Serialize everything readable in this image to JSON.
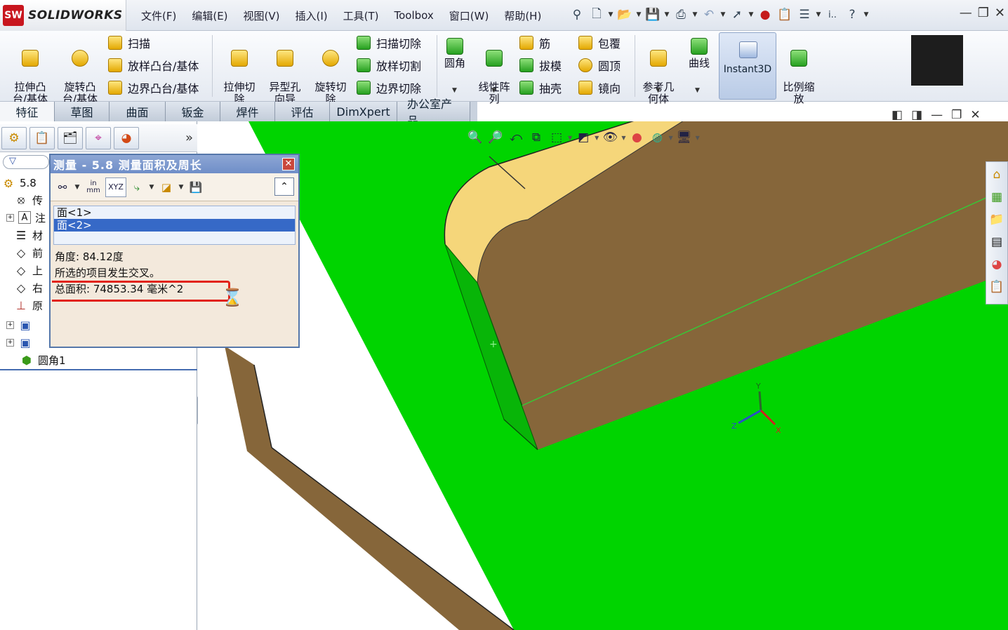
{
  "app": {
    "name": "SOLIDWORKS",
    "logo_mark": "SW"
  },
  "menu": [
    "文件(F)",
    "编辑(E)",
    "视图(V)",
    "插入(I)",
    "工具(T)",
    "Toolbox",
    "窗口(W)",
    "帮助(H)"
  ],
  "quick_access": {
    "ellipsis": "i..",
    "help": "?"
  },
  "commands": {
    "extrude_boss": "拉伸凸\n台/基体",
    "revolve_boss": "旋转凸\n台/基体",
    "sweep": "扫描",
    "loft": "放样凸台/基体",
    "boundary_boss": "边界凸台/基体",
    "extrude_cut": "拉伸切\n除",
    "hole_wizard": "异型孔\n向导",
    "revolve_cut": "旋转切\n除",
    "swept_cut": "扫描切除",
    "lofted_cut": "放样切割",
    "boundary_cut": "边界切除",
    "fillet": "圆角",
    "linear_pattern": "线性阵\n列",
    "rib": "筋",
    "draft": "拔模",
    "shell": "抽壳",
    "wrap": "包覆",
    "dome": "圆顶",
    "mirror": "镜向",
    "ref_geometry": "参考几\n何体",
    "curves": "曲线",
    "instant3d": "Instant3D",
    "scale": "比例缩\n放"
  },
  "tabs": [
    "特征",
    "草图",
    "曲面",
    "钣金",
    "焊件",
    "评估",
    "DimXpert",
    "办公室产品"
  ],
  "active_tab": 0,
  "tree": {
    "root": "5.8",
    "items": [
      "传",
      "注",
      "材",
      "前",
      "上",
      "右",
      "原",
      "",
      ""
    ],
    "last_item": "圆角1"
  },
  "measure": {
    "title": "测量 - 5.8 测量面积及周长",
    "units_top": "in",
    "units_bottom": "mm",
    "xyz": "XYZ",
    "selections": [
      "面<1>",
      "面<2>"
    ],
    "selected_index": 1,
    "results": [
      "角度: 84.12度",
      "所选的项目发生交叉。",
      "总面积: 74853.34 毫米^2"
    ]
  },
  "colors": {
    "model_face_green": "#00d400",
    "model_face_brown": "#86663a",
    "model_edge_yellow": "#f5d67a",
    "selection_blue": "#3669c7",
    "highlight_red": "#e2231a"
  },
  "triad": {
    "x": "X",
    "y": "Y",
    "z": "Z"
  }
}
